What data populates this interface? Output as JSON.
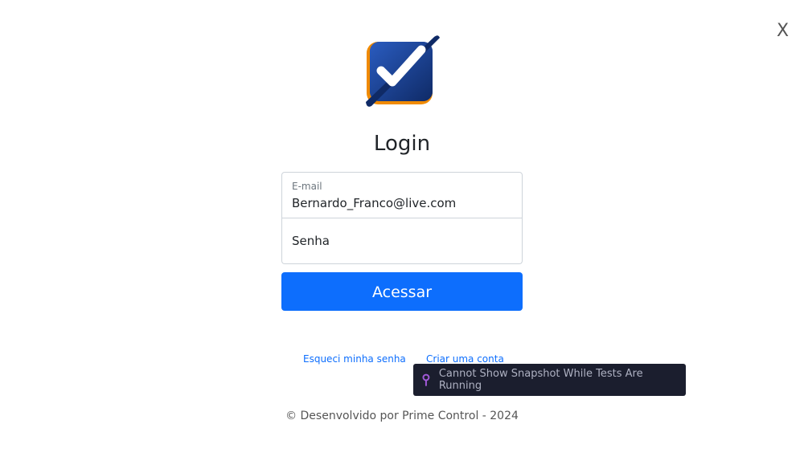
{
  "close_label": "X",
  "logo": {
    "icon": "checkmark-logo-icon",
    "colors": {
      "orange": "#f08a00",
      "blue": "#1a3f8a"
    }
  },
  "title": "Login",
  "form": {
    "email_label": "E-mail",
    "email_value": "Bernardo_Franco@live.com",
    "password_placeholder": "Senha",
    "submit_label": "Acessar"
  },
  "links": {
    "forgot": "Esqueci minha senha",
    "create": "Criar uma conta"
  },
  "tooltip": {
    "icon": "pin-icon",
    "text": "Cannot Show Snapshot While Tests Are Running"
  },
  "footer": "© Desenvolvido por Prime Control - 2024",
  "colors": {
    "primary": "#0d6efd",
    "tooltip_bg": "#1b1e2e",
    "pin": "#a259d9"
  }
}
